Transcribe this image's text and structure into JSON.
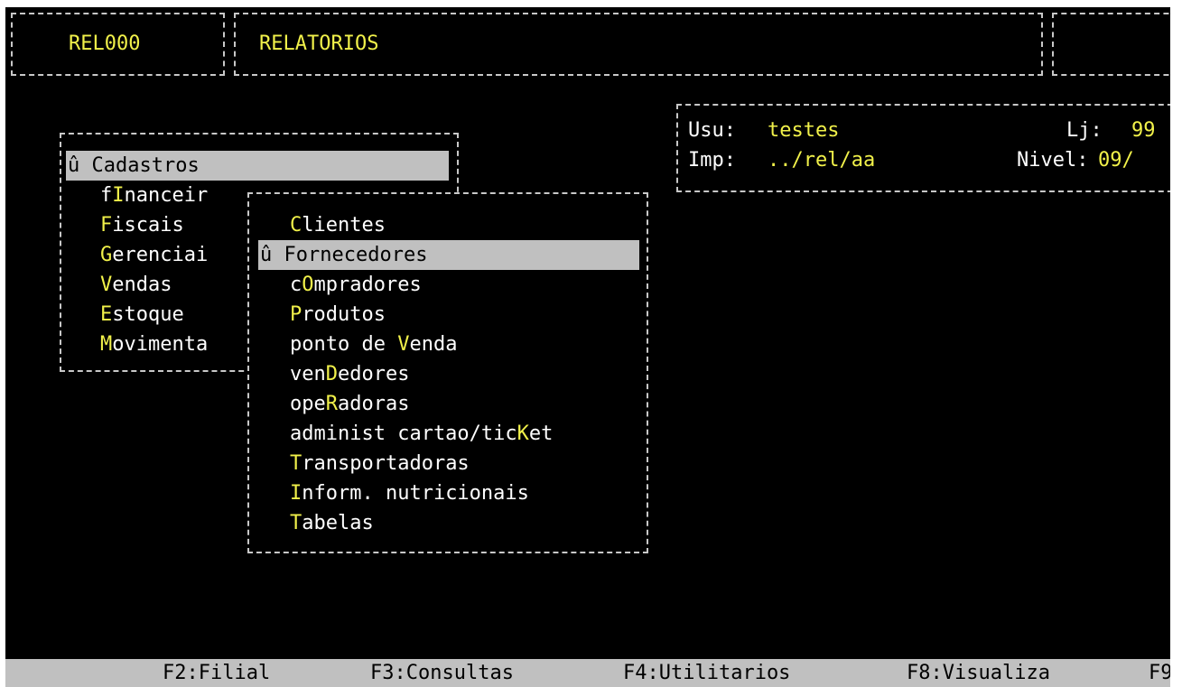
{
  "header": {
    "program_code": "REL000",
    "program_title": "RELATORIOS"
  },
  "info": {
    "user_label": "Usu:",
    "user_value": "testes",
    "store_label": "Lj:",
    "store_value": "99",
    "printer_label": "Imp:",
    "printer_value": "../rel/aa",
    "level_label": "Nivel:",
    "level_value": "09/"
  },
  "main_menu": {
    "marker": "û",
    "items": [
      {
        "label": "Cadastros",
        "hotkey_index": 0,
        "selected": true
      },
      {
        "label": "fInanceir",
        "hotkey_index": 1
      },
      {
        "label": "Fiscais",
        "hotkey_index": 0
      },
      {
        "label": "Gerenciai",
        "hotkey_index": 0
      },
      {
        "label": "Vendas",
        "hotkey_index": 0
      },
      {
        "label": "Estoque",
        "hotkey_index": 0
      },
      {
        "label": "Movimenta",
        "hotkey_index": 0
      }
    ]
  },
  "submenu": {
    "marker": "û",
    "items": [
      {
        "label": "Clientes",
        "hotkey_index": 0
      },
      {
        "label": "Fornecedores",
        "hotkey_index": 0,
        "selected": true
      },
      {
        "label": "cOmpradores",
        "hotkey_index": 1
      },
      {
        "label": "Produtos",
        "hotkey_index": 0
      },
      {
        "label": "ponto de Venda",
        "hotkey_index": 9
      },
      {
        "label": "venDedores",
        "hotkey_index": 3
      },
      {
        "label": "opeRadoras",
        "hotkey_index": 3
      },
      {
        "label": "administ cartao/ticKet",
        "hotkey_index": 19
      },
      {
        "label": "Transportadoras",
        "hotkey_index": 0
      },
      {
        "label": "Inform. nutricionais",
        "hotkey_index": 0
      },
      {
        "label": "Tabelas",
        "hotkey_index": 0
      }
    ]
  },
  "function_keys": [
    {
      "label": "F2:Filial"
    },
    {
      "label": "F3:Consultas"
    },
    {
      "label": "F4:Utilitarios"
    },
    {
      "label": "F8:Visualiza"
    },
    {
      "label": "F9"
    }
  ],
  "colors": {
    "background": "#000000",
    "text": "#ffffff",
    "highlight_text": "#f1f14a",
    "selection_bar": "#c0c0c0",
    "border": "#c8c8c8"
  }
}
